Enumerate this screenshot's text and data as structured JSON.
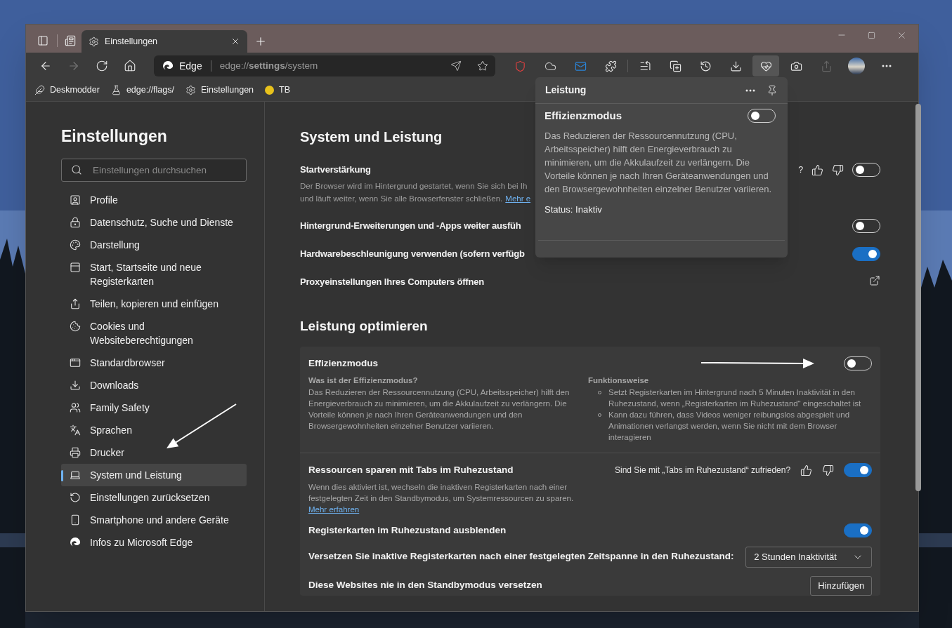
{
  "browser": {
    "tabs": [
      {
        "label": "Einstellungen",
        "selected": true
      }
    ],
    "address_bar": {
      "site": "Edge",
      "url": "edge://**settings**/system"
    },
    "nav_buttons": [
      {
        "disabled": false
      },
      {
        "disabled": true
      },
      {
        "disabled": false
      },
      {
        "disabled": false
      }
    ],
    "toolbar_buttons": [
      {
        "selected": false,
        "disabled": false
      },
      {
        "selected": false,
        "disabled": false
      },
      {
        "selected": false,
        "disabled": false
      },
      {
        "selected": false,
        "disabled": false
      },
      {
        "selected": false,
        "disabled": false
      },
      {
        "selected": false,
        "disabled": false
      },
      {
        "selected": false,
        "disabled": false
      },
      {
        "selected": false,
        "disabled": false
      },
      {
        "selected": true,
        "disabled": false
      },
      {
        "selected": false,
        "disabled": false
      },
      {
        "selected": false,
        "disabled": true
      },
      {
        "selected": false,
        "disabled": false
      },
      {
        "selected": false,
        "disabled": false
      }
    ],
    "favorites": [
      {
        "label": "Deskmodder"
      },
      {
        "label": "edge://flags/"
      },
      {
        "label": "Einstellungen"
      },
      {
        "label": "TB"
      }
    ]
  },
  "sidebar": {
    "title": "Einstellungen",
    "search": {
      "placeholder": "Einstellungen durchsuchen"
    },
    "items": [
      {
        "label": "Profile",
        "selected": false
      },
      {
        "label": "Datenschutz, Suche und Dienste",
        "selected": false
      },
      {
        "label": "Darstellung",
        "selected": false
      },
      {
        "label": "Start, Startseite und neue Registerkarten",
        "selected": false
      },
      {
        "label": "Teilen, kopieren und einfügen",
        "selected": false
      },
      {
        "label": "Cookies und Websiteberechtigungen",
        "selected": false
      },
      {
        "label": "Standardbrowser",
        "selected": false
      },
      {
        "label": "Downloads",
        "selected": false
      },
      {
        "label": "Family Safety",
        "selected": false
      },
      {
        "label": "Sprachen",
        "selected": false
      },
      {
        "label": "Drucker",
        "selected": false
      },
      {
        "label": "System und Leistung",
        "selected": true
      },
      {
        "label": "Einstellungen zurücksetzen",
        "selected": false
      },
      {
        "label": "Smartphone und andere Geräte",
        "selected": false
      },
      {
        "label": "Infos zu Microsoft Edge",
        "selected": false
      }
    ]
  },
  "page": {
    "title": "System und Leistung",
    "settings": [
      {
        "kind": "toggle",
        "title": "Startverstärkung",
        "description": "Der Browser wird im Hintergrund gestartet, wenn Sie sich bei Ih",
        "description_2": "und läuft weiter, wenn Sie alle Browserfenster schließen.",
        "link": "Mehr e",
        "feedback": "?",
        "on": false
      },
      {
        "kind": "toggle",
        "title": "Hintergrund-Erweiterungen und -Apps weiter ausfüh",
        "on": false
      },
      {
        "kind": "toggle",
        "title": "Hardwarebeschleunigung verwenden (sofern verfügb",
        "on": true
      },
      {
        "kind": "link",
        "title": "Proxyeinstellungen Ihres Computers öffnen"
      }
    ],
    "section_title": "Leistung optimieren",
    "efficiency": {
      "title": "Effizienzmodus",
      "on": false,
      "what_title": "Was ist der Effizienzmodus?",
      "what_text": "Das Reduzieren der Ressourcennutzung (CPU, Arbeitsspeicher) hilft den Energieverbrauch zu minimieren, um die Akkulaufzeit zu verlängern. Die Vorteile können je nach Ihren Geräteanwendungen und den Browsergewohnheiten einzelner Benutzer variieren.",
      "how_title": "Funktionsweise",
      "how_items": [
        "Setzt Registerkarten im Hintergrund nach 5 Minuten Inaktivität in den Ruhezustand, wenn „Registerkarten im Ruhezustand“ eingeschaltet ist",
        "Kann dazu führen, dass Videos weniger reibungslos abgespielt und Animationen verlangst werden, wenn Sie nicht mit dem Browser interagieren"
      ]
    },
    "rows": [
      {
        "kind": "toggle",
        "title": "Ressourcen sparen mit Tabs im Ruhezustand",
        "description": "Wenn dies aktiviert ist, wechseln die inaktiven Registerkarten nach einer festgelegten Zeit in den Standbymodus, um Systemressourcen zu sparen.",
        "link": "Mehr erfahren",
        "feedback": "Sind Sie mit „Tabs im Ruhezustand“ zufrieden?",
        "on": true
      },
      {
        "kind": "toggle",
        "title": "Registerkarten im Ruhezustand ausblenden",
        "on": true
      },
      {
        "kind": "select",
        "title": "Versetzen Sie inaktive Registerkarten nach einer festgelegten Zeitspanne in den Ruhezustand:",
        "value": "2 Stunden Inaktivität"
      },
      {
        "kind": "button",
        "title": "Diese Websites nie in den Standbymodus versetzen",
        "button": "Hinzufügen"
      }
    ]
  },
  "popup": {
    "title": "Leistung",
    "heading": "Effizienzmodus",
    "on": false,
    "text": "Das Reduzieren der Ressourcennutzung (CPU, Arbeitsspeicher) hilft den Energieverbrauch zu minimieren, um die Akkulaufzeit zu verlängern. Die Vorteile können je nach Ihren Geräteanwendungen und den Browsergewohnheiten einzelner Benutzer variieren.",
    "status": "Status: Inaktiv"
  }
}
